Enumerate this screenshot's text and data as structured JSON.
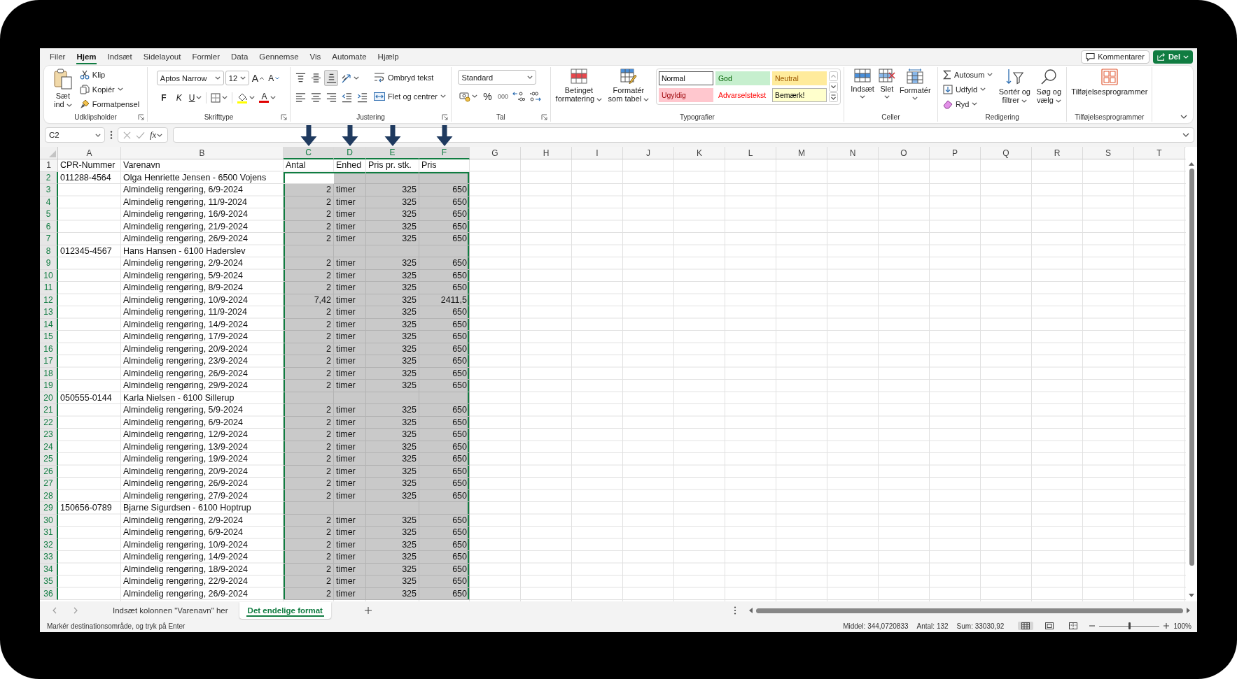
{
  "menu": {
    "tabs": [
      {
        "label": "Filer",
        "selected": false
      },
      {
        "label": "Hjem",
        "selected": true
      },
      {
        "label": "Indsæt",
        "selected": false
      },
      {
        "label": "Sidelayout",
        "selected": false
      },
      {
        "label": "Formler",
        "selected": false
      },
      {
        "label": "Data",
        "selected": false
      },
      {
        "label": "Gennemse",
        "selected": false
      },
      {
        "label": "Vis",
        "selected": false
      },
      {
        "label": "Automate",
        "selected": false
      },
      {
        "label": "Hjælp",
        "selected": false
      }
    ],
    "comments_button": "Kommentarer",
    "share_button": "Del"
  },
  "ribbon": {
    "clipboard": {
      "paste": "Sæt ind",
      "cut": "Klip",
      "copy": "Kopiér",
      "format_painter": "Formatpensel",
      "label": "Udklipsholder"
    },
    "font": {
      "font_name": "Aptos Narrow",
      "font_size": "12",
      "grow_font": "A",
      "shrink_font": "A",
      "bold": "F",
      "italic": "K",
      "underline": "U",
      "font_color": "A",
      "label": "Skrifttype"
    },
    "alignment": {
      "vertical": [
        {
          "kind": "top",
          "selected": false
        },
        {
          "kind": "middle",
          "selected": false
        },
        {
          "kind": "bottom",
          "selected": true
        }
      ],
      "horizontal": [
        {
          "kind": "left",
          "selected": false
        },
        {
          "kind": "center",
          "selected": false
        },
        {
          "kind": "right",
          "selected": false
        }
      ],
      "wrap_text": "Ombryd tekst",
      "merge": "Flet og centrer",
      "label": "Justering"
    },
    "number": {
      "format": "Standard",
      "percent": "%",
      "thousands": "000",
      "label": "Tal"
    },
    "styles": {
      "conditional_formatting": "Betinget formatering",
      "format_as_table": "Formatér som tabel",
      "cell_styles": [
        {
          "label": "Normal",
          "kind": "normal",
          "selected": true
        },
        {
          "label": "God",
          "kind": "good",
          "selected": false
        },
        {
          "label": "Neutral",
          "kind": "neutral",
          "selected": false
        },
        {
          "label": "Ugyldig",
          "kind": "bad",
          "selected": false
        },
        {
          "label": "Advarselstekst",
          "kind": "warning",
          "selected": false
        },
        {
          "label": "Bemærk!",
          "kind": "note",
          "selected": false
        }
      ],
      "label": "Typografier"
    },
    "cells": {
      "insert": "Indsæt",
      "delete": "Slet",
      "format": "Formatér",
      "label": "Celler"
    },
    "editing": {
      "autosum": "Autosum",
      "fill": "Udfyld",
      "clear": "Ryd",
      "sort_filter": "Sortér og filtrer",
      "find_select": "Søg og vælg",
      "label": "Redigering"
    },
    "add_ins": {
      "button": "Tilføjelsesprogrammer",
      "label": "Tilføjelsesprogrammer"
    }
  },
  "formula_bar": {
    "name_box": "C2",
    "function_button": "fx"
  },
  "sheet": {
    "columns": [
      {
        "label": "A",
        "selected": false,
        "active": false,
        "arrow": false
      },
      {
        "label": "B",
        "selected": false,
        "active": false,
        "arrow": false
      },
      {
        "label": "C",
        "selected": true,
        "active": true,
        "arrow": true
      },
      {
        "label": "D",
        "selected": true,
        "active": false,
        "arrow": true
      },
      {
        "label": "E",
        "selected": true,
        "active": false,
        "arrow": true
      },
      {
        "label": "F",
        "selected": true,
        "active": false,
        "arrow": true
      },
      {
        "label": "G",
        "selected": false,
        "active": false,
        "arrow": false
      },
      {
        "label": "H",
        "selected": false,
        "active": false,
        "arrow": false
      },
      {
        "label": "I",
        "selected": false,
        "active": false,
        "arrow": false
      },
      {
        "label": "J",
        "selected": false,
        "active": false,
        "arrow": false
      },
      {
        "label": "K",
        "selected": false,
        "active": false,
        "arrow": false
      },
      {
        "label": "L",
        "selected": false,
        "active": false,
        "arrow": false
      },
      {
        "label": "M",
        "selected": false,
        "active": false,
        "arrow": false
      },
      {
        "label": "N",
        "selected": false,
        "active": false,
        "arrow": false
      },
      {
        "label": "O",
        "selected": false,
        "active": false,
        "arrow": false
      },
      {
        "label": "P",
        "selected": false,
        "active": false,
        "arrow": false
      },
      {
        "label": "Q",
        "selected": false,
        "active": false,
        "arrow": false
      },
      {
        "label": "R",
        "selected": false,
        "active": false,
        "arrow": false
      },
      {
        "label": "S",
        "selected": false,
        "active": false,
        "arrow": false
      },
      {
        "label": "T",
        "selected": false,
        "active": false,
        "arrow": false
      }
    ],
    "rows": [
      {
        "number": "1",
        "selected": false,
        "active": false,
        "cpr_number": "CPR-Nummer",
        "item_name": "Varenavn",
        "quantity": "Antal",
        "unit": "Enhed",
        "unit_price": "Pris pr. stk.",
        "price": "Pris"
      },
      {
        "number": "2",
        "selected": true,
        "active": true,
        "cpr_number": "011288-4564",
        "item_name": "Olga Henriette Jensen - 6500 Vojens"
      },
      {
        "number": "3",
        "selected": true,
        "active": false,
        "item_name": "Almindelig rengøring, 6/9-2024",
        "quantity": "2",
        "unit": "timer",
        "unit_price": "325",
        "price": "650"
      },
      {
        "number": "4",
        "selected": true,
        "active": false,
        "item_name": "Almindelig rengøring, 11/9-2024",
        "quantity": "2",
        "unit": "timer",
        "unit_price": "325",
        "price": "650"
      },
      {
        "number": "5",
        "selected": true,
        "active": false,
        "item_name": "Almindelig rengøring, 16/9-2024",
        "quantity": "2",
        "unit": "timer",
        "unit_price": "325",
        "price": "650"
      },
      {
        "number": "6",
        "selected": true,
        "active": false,
        "item_name": "Almindelig rengøring, 21/9-2024",
        "quantity": "2",
        "unit": "timer",
        "unit_price": "325",
        "price": "650"
      },
      {
        "number": "7",
        "selected": true,
        "active": false,
        "item_name": "Almindelig rengøring, 26/9-2024",
        "quantity": "2",
        "unit": "timer",
        "unit_price": "325",
        "price": "650"
      },
      {
        "number": "8",
        "selected": true,
        "active": false,
        "cpr_number": "012345-4567",
        "item_name": "Hans Hansen - 6100 Haderslev"
      },
      {
        "number": "9",
        "selected": true,
        "active": false,
        "item_name": "Almindelig rengøring, 2/9-2024",
        "quantity": "2",
        "unit": "timer",
        "unit_price": "325",
        "price": "650"
      },
      {
        "number": "10",
        "selected": true,
        "active": false,
        "item_name": "Almindelig rengøring, 5/9-2024",
        "quantity": "2",
        "unit": "timer",
        "unit_price": "325",
        "price": "650"
      },
      {
        "number": "11",
        "selected": true,
        "active": false,
        "item_name": "Almindelig rengøring, 8/9-2024",
        "quantity": "2",
        "unit": "timer",
        "unit_price": "325",
        "price": "650"
      },
      {
        "number": "12",
        "selected": true,
        "active": false,
        "item_name": "Almindelig rengøring, 10/9-2024",
        "quantity": "7,42",
        "unit": "timer",
        "unit_price": "325",
        "price": "2411,5"
      },
      {
        "number": "13",
        "selected": true,
        "active": false,
        "item_name": "Almindelig rengøring, 11/9-2024",
        "quantity": "2",
        "unit": "timer",
        "unit_price": "325",
        "price": "650"
      },
      {
        "number": "14",
        "selected": true,
        "active": false,
        "item_name": "Almindelig rengøring, 14/9-2024",
        "quantity": "2",
        "unit": "timer",
        "unit_price": "325",
        "price": "650"
      },
      {
        "number": "15",
        "selected": true,
        "active": false,
        "item_name": "Almindelig rengøring, 17/9-2024",
        "quantity": "2",
        "unit": "timer",
        "unit_price": "325",
        "price": "650"
      },
      {
        "number": "16",
        "selected": true,
        "active": false,
        "item_name": "Almindelig rengøring, 20/9-2024",
        "quantity": "2",
        "unit": "timer",
        "unit_price": "325",
        "price": "650"
      },
      {
        "number": "17",
        "selected": true,
        "active": false,
        "item_name": "Almindelig rengøring, 23/9-2024",
        "quantity": "2",
        "unit": "timer",
        "unit_price": "325",
        "price": "650"
      },
      {
        "number": "18",
        "selected": true,
        "active": false,
        "item_name": "Almindelig rengøring, 26/9-2024",
        "quantity": "2",
        "unit": "timer",
        "unit_price": "325",
        "price": "650"
      },
      {
        "number": "19",
        "selected": true,
        "active": false,
        "item_name": "Almindelig rengøring, 29/9-2024",
        "quantity": "2",
        "unit": "timer",
        "unit_price": "325",
        "price": "650"
      },
      {
        "number": "20",
        "selected": true,
        "active": false,
        "cpr_number": "050555-0144",
        "item_name": "Karla Nielsen - 6100 Sillerup"
      },
      {
        "number": "21",
        "selected": true,
        "active": false,
        "item_name": "Almindelig rengøring, 5/9-2024",
        "quantity": "2",
        "unit": "timer",
        "unit_price": "325",
        "price": "650"
      },
      {
        "number": "22",
        "selected": true,
        "active": false,
        "item_name": "Almindelig rengøring, 6/9-2024",
        "quantity": "2",
        "unit": "timer",
        "unit_price": "325",
        "price": "650"
      },
      {
        "number": "23",
        "selected": true,
        "active": false,
        "item_name": "Almindelig rengøring, 12/9-2024",
        "quantity": "2",
        "unit": "timer",
        "unit_price": "325",
        "price": "650"
      },
      {
        "number": "24",
        "selected": true,
        "active": false,
        "item_name": "Almindelig rengøring, 13/9-2024",
        "quantity": "2",
        "unit": "timer",
        "unit_price": "325",
        "price": "650"
      },
      {
        "number": "25",
        "selected": true,
        "active": false,
        "item_name": "Almindelig rengøring, 19/9-2024",
        "quantity": "2",
        "unit": "timer",
        "unit_price": "325",
        "price": "650"
      },
      {
        "number": "26",
        "selected": true,
        "active": false,
        "item_name": "Almindelig rengøring, 20/9-2024",
        "quantity": "2",
        "unit": "timer",
        "unit_price": "325",
        "price": "650"
      },
      {
        "number": "27",
        "selected": true,
        "active": false,
        "item_name": "Almindelig rengøring, 26/9-2024",
        "quantity": "2",
        "unit": "timer",
        "unit_price": "325",
        "price": "650"
      },
      {
        "number": "28",
        "selected": true,
        "active": false,
        "item_name": "Almindelig rengøring, 27/9-2024",
        "quantity": "2",
        "unit": "timer",
        "unit_price": "325",
        "price": "650"
      },
      {
        "number": "29",
        "selected": true,
        "active": false,
        "cpr_number": "150656-0789",
        "item_name": "Bjarne Sigurdsen - 6100 Hoptrup"
      },
      {
        "number": "30",
        "selected": true,
        "active": false,
        "item_name": "Almindelig rengøring, 2/9-2024",
        "quantity": "2",
        "unit": "timer",
        "unit_price": "325",
        "price": "650"
      },
      {
        "number": "31",
        "selected": true,
        "active": false,
        "item_name": "Almindelig rengøring, 6/9-2024",
        "quantity": "2",
        "unit": "timer",
        "unit_price": "325",
        "price": "650"
      },
      {
        "number": "32",
        "selected": true,
        "active": false,
        "item_name": "Almindelig rengøring, 10/9-2024",
        "quantity": "2",
        "unit": "timer",
        "unit_price": "325",
        "price": "650"
      },
      {
        "number": "33",
        "selected": true,
        "active": false,
        "item_name": "Almindelig rengøring, 14/9-2024",
        "quantity": "2",
        "unit": "timer",
        "unit_price": "325",
        "price": "650"
      },
      {
        "number": "34",
        "selected": true,
        "active": false,
        "item_name": "Almindelig rengøring, 18/9-2024",
        "quantity": "2",
        "unit": "timer",
        "unit_price": "325",
        "price": "650"
      },
      {
        "number": "35",
        "selected": true,
        "active": false,
        "item_name": "Almindelig rengøring, 22/9-2024",
        "quantity": "2",
        "unit": "timer",
        "unit_price": "325",
        "price": "650"
      },
      {
        "number": "36",
        "selected": true,
        "active": false,
        "item_name": "Almindelig rengøring, 26/9-2024",
        "quantity": "2",
        "unit": "timer",
        "unit_price": "325",
        "price": "650"
      }
    ]
  },
  "sheet_tabs": [
    {
      "label": "Indsæt kolonnen \"Varenavn\" her",
      "selected": false
    },
    {
      "label": "Det endelige format",
      "selected": true
    }
  ],
  "status_bar": {
    "message": "Markér destinationsområde, og tryk på Enter",
    "average": "Middel: 344,0720833",
    "count": "Antal: 132",
    "sum": "Sum: 33030,92",
    "views": [
      {
        "kind": "normal",
        "selected": true
      },
      {
        "kind": "page_layout",
        "selected": false
      },
      {
        "kind": "page_break",
        "selected": false
      }
    ],
    "zoom": {
      "level": 0.5,
      "label": "100%"
    }
  }
}
